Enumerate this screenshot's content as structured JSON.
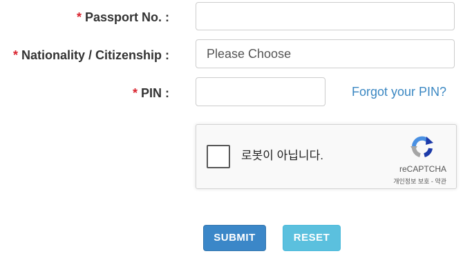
{
  "form": {
    "passport": {
      "required_mark": "*",
      "label": "Passport No. :",
      "value": ""
    },
    "nationality": {
      "required_mark": "*",
      "label": "Nationality / Citizenship :",
      "selected": "Please Choose"
    },
    "pin": {
      "required_mark": "*",
      "label": "PIN :",
      "value": "",
      "forgot_link": "Forgot your PIN?"
    }
  },
  "captcha": {
    "checkbox_label": "로봇이 아닙니다.",
    "checked": false,
    "brand": "reCAPTCHA",
    "terms": "개인정보 보호 - 약관",
    "icon": "recaptcha-logo-icon"
  },
  "buttons": {
    "submit_label": "SUBMIT",
    "reset_label": "RESET"
  },
  "colors": {
    "required": "#d9232e",
    "link": "#3a87c2",
    "submit_bg": "#3b87c8",
    "reset_bg": "#5bc0de"
  }
}
